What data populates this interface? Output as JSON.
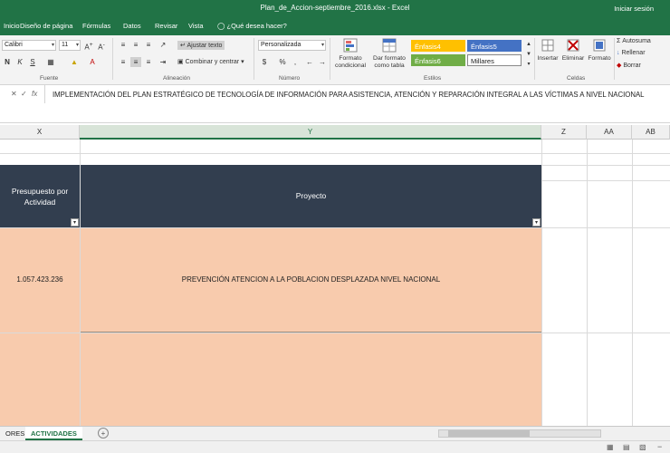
{
  "window": {
    "title": "Plan_de_Accion-septiembre_2016.xlsx - Excel",
    "signin": "Iniciar sesión"
  },
  "ribbon_tabs": [
    {
      "label": "Inicio"
    },
    {
      "label": "Diseño de página"
    },
    {
      "label": "Fórmulas"
    },
    {
      "label": "Datos"
    },
    {
      "label": "Revisar"
    },
    {
      "label": "Vista"
    }
  ],
  "tell_me": "¿Qué desea hacer?",
  "ribbon": {
    "font": {
      "name": "Calibri",
      "size": "11",
      "group_label": "Fuente"
    },
    "alignment": {
      "wrap_text": "Ajustar texto",
      "merge_center": "Combinar y centrar",
      "group_label": "Alineación"
    },
    "number": {
      "format": "Personalizada",
      "group_label": "Número"
    },
    "styles": {
      "conditional_format": "Formato condicional",
      "format_table": "Dar formato como tabla",
      "cells": [
        {
          "label": "Énfasis4",
          "color": "#ffc000"
        },
        {
          "label": "Énfasis5",
          "color": "#4472c4"
        },
        {
          "label": "Énfasis6",
          "color": "#70ad47"
        },
        {
          "label": "Millares",
          "color": "#ffffff"
        }
      ],
      "group_label": "Estilos"
    },
    "cells_group": {
      "insert": "Insertar",
      "delete": "Eliminar",
      "format": "Formato",
      "group_label": "Celdas"
    },
    "editing": {
      "autosum": "Autosuma",
      "fill": "Rellenar",
      "clear": "Borrar"
    }
  },
  "formula_bar": {
    "content": "IMPLEMENTACIÓN DEL PLAN ESTRATÉGICO DE TECNOLOGÍA DE INFORMACIÓN PARA ASISTENCIA, ATENCIÓN Y REPARACIÓN INTEGRAL A LAS VÍCTIMAS A NIVEL NACIONAL"
  },
  "columns": [
    {
      "label": "X"
    },
    {
      "label": "Y"
    },
    {
      "label": "Z"
    },
    {
      "label": "AA"
    },
    {
      "label": "AB"
    }
  ],
  "table": {
    "headers": [
      {
        "label": "Presupuesto por Actividad"
      },
      {
        "label": "Proyecto"
      }
    ],
    "rows": [
      {
        "presupuesto": "1.057.423.236",
        "proyecto": "PREVENCIÓN ATENCION A LA POBLACION DESPLAZADA NIVEL NACIONAL"
      },
      {
        "presupuesto": "",
        "proyecto": ""
      }
    ],
    "header_color": "#323e4f",
    "row_color": "#f8cbad"
  },
  "sheets": [
    {
      "label": "ORES"
    },
    {
      "label": "ACTIVIDADES",
      "active": true
    }
  ],
  "accent": "#217346"
}
